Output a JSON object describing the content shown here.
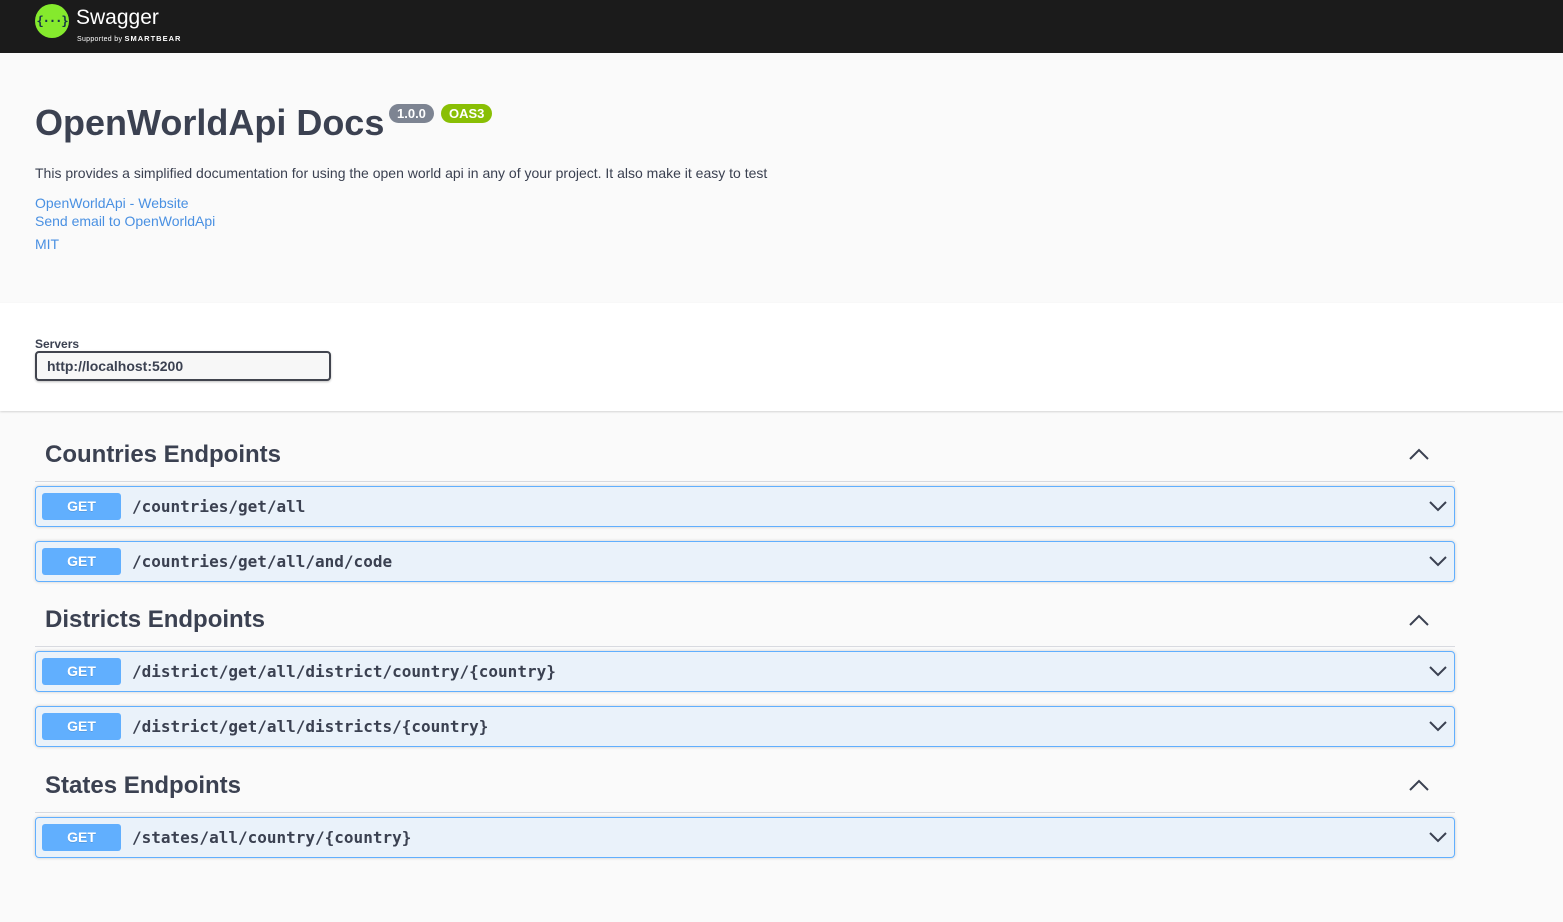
{
  "topbar": {
    "logo_glyph": "{···}",
    "brand": "Swagger",
    "supported_by": "Supported by",
    "sponsor": "SMARTBEAR",
    "logo_color": "#85ea2d"
  },
  "info": {
    "title": "OpenWorldApi Docs",
    "version": "1.0.0",
    "spec": "OAS3",
    "description": "This provides a simplified documentation for using the open world api in any of your project. It also make it easy to test",
    "links": [
      "OpenWorldApi - Website",
      "Send email to OpenWorldApi",
      "MIT"
    ]
  },
  "servers": {
    "label": "Servers",
    "selected": "http://localhost:5200"
  },
  "groups": [
    {
      "title": "Countries Endpoints",
      "endpoints": [
        {
          "method": "GET",
          "path": "/countries/get/all"
        },
        {
          "method": "GET",
          "path": "/countries/get/all/and/code"
        }
      ]
    },
    {
      "title": "Districts Endpoints",
      "endpoints": [
        {
          "method": "GET",
          "path": "/district/get/all/district/country/{country}"
        },
        {
          "method": "GET",
          "path": "/district/get/all/districts/{country}"
        }
      ]
    },
    {
      "title": "States Endpoints",
      "endpoints": [
        {
          "method": "GET",
          "path": "/states/all/country/{country}"
        }
      ]
    }
  ],
  "colors": {
    "get_method": "#61affe",
    "version_badge": "#7d8492",
    "oas_badge": "#89bf04",
    "link": "#4990e2"
  }
}
